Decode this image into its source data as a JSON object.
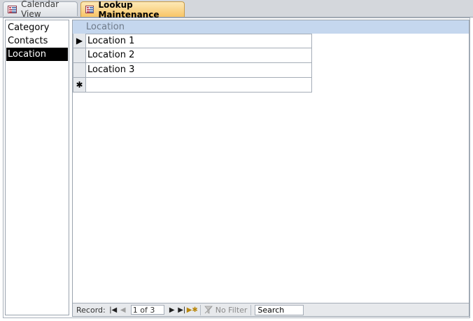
{
  "tabs": [
    {
      "label": "Calendar View",
      "icon": "form-icon",
      "active": false
    },
    {
      "label": "Lookup Maintenance",
      "icon": "form-icon",
      "active": true
    }
  ],
  "listbox": {
    "items": [
      "Category",
      "Contacts",
      "Location"
    ],
    "selected": "Location"
  },
  "datasheet": {
    "column_header": "Location",
    "rows": [
      {
        "indicator": "▶",
        "value": "Location 1"
      },
      {
        "indicator": "",
        "value": "Location 2"
      },
      {
        "indicator": "",
        "value": "Location 3"
      },
      {
        "indicator": "✱",
        "value": ""
      }
    ]
  },
  "navbar": {
    "record_label": "Record:",
    "record_value": "1 of 3",
    "filter_label": "No Filter",
    "search_text": "Search"
  },
  "colors": {
    "active_tab": "#f8c566",
    "header_bg": "#c5d7ee",
    "selection_bg": "#000000"
  }
}
